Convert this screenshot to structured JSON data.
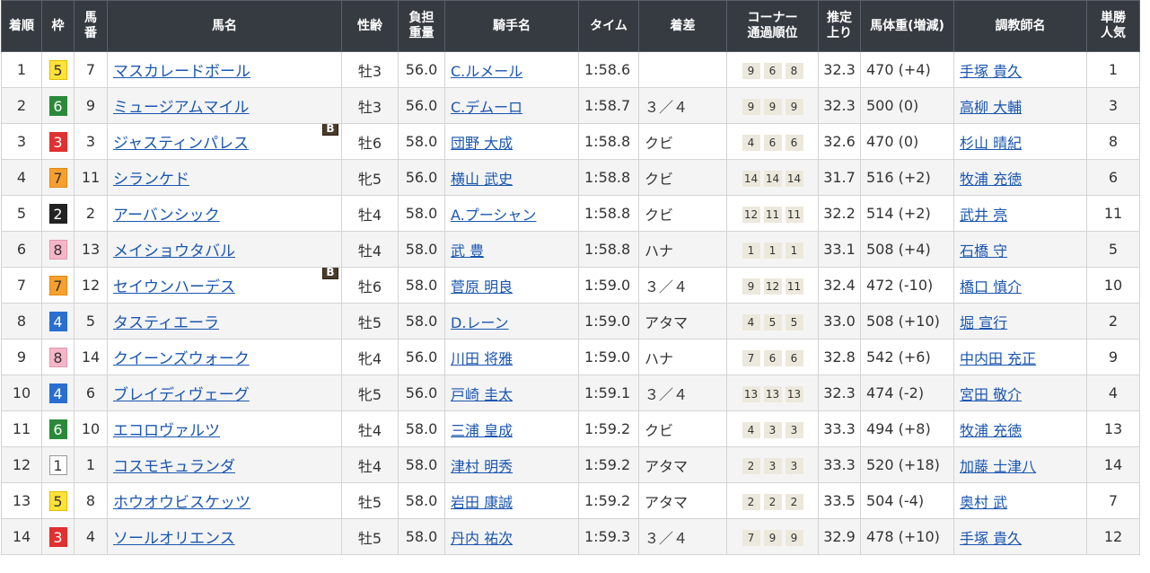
{
  "headers": {
    "rank": "着順",
    "waku": "枠",
    "num": "馬番",
    "horse": "馬名",
    "sexage": "性齢",
    "weight": "負担重量",
    "jockey": "騎手名",
    "time": "タイム",
    "margin": "着差",
    "corner": "コーナー通過順位",
    "last3f": "推定上り",
    "body": "馬体重(増減)",
    "trainer": "調教師名",
    "pop": "単勝人気"
  },
  "blinker_label": "B",
  "waku_colors": {
    "1": {
      "bg": "#ffffff",
      "fg": "#333333",
      "border": "#999999"
    },
    "2": {
      "bg": "#222222",
      "fg": "#ffffff",
      "border": "#222222"
    },
    "3": {
      "bg": "#e03030",
      "fg": "#ffffff",
      "border": "#e03030"
    },
    "4": {
      "bg": "#2a6fd0",
      "fg": "#ffffff",
      "border": "#2a6fd0"
    },
    "5": {
      "bg": "#ffe23a",
      "fg": "#333333",
      "border": "#e0c000"
    },
    "6": {
      "bg": "#2a8a3a",
      "fg": "#ffffff",
      "border": "#2a8a3a"
    },
    "7": {
      "bg": "#f7a030",
      "fg": "#333333",
      "border": "#e08a10"
    },
    "8": {
      "bg": "#f7b6c8",
      "fg": "#333333",
      "border": "#e09ab0"
    }
  },
  "rows": [
    {
      "rank": "1",
      "waku": "5",
      "num": "7",
      "horse": "マスカレードボール",
      "blinker": false,
      "sexage": "牡3",
      "weight": "56.0",
      "jockey": "C.ルメール",
      "time": "1:58.6",
      "margin": "",
      "corner": [
        "9",
        "6",
        "8"
      ],
      "last3f": "32.3",
      "body": "470 (+4)",
      "trainer": "手塚 貴久",
      "pop": "1"
    },
    {
      "rank": "2",
      "waku": "6",
      "num": "9",
      "horse": "ミュージアムマイル",
      "blinker": false,
      "sexage": "牡3",
      "weight": "56.0",
      "jockey": "C.デムーロ",
      "time": "1:58.7",
      "margin": "３／４",
      "corner": [
        "9",
        "9",
        "9"
      ],
      "last3f": "32.3",
      "body": "500 (0)",
      "trainer": "高柳 大輔",
      "pop": "3"
    },
    {
      "rank": "3",
      "waku": "3",
      "num": "3",
      "horse": "ジャスティンパレス",
      "blinker": true,
      "sexage": "牡6",
      "weight": "58.0",
      "jockey": "団野 大成",
      "time": "1:58.8",
      "margin": "クビ",
      "corner": [
        "4",
        "6",
        "6"
      ],
      "last3f": "32.6",
      "body": "470 (0)",
      "trainer": "杉山 晴紀",
      "pop": "8"
    },
    {
      "rank": "4",
      "waku": "7",
      "num": "11",
      "horse": "シランケド",
      "blinker": false,
      "sexage": "牝5",
      "weight": "56.0",
      "jockey": "横山 武史",
      "time": "1:58.8",
      "margin": "クビ",
      "corner": [
        "14",
        "14",
        "14"
      ],
      "last3f": "31.7",
      "body": "516 (+2)",
      "trainer": "牧浦 充徳",
      "pop": "6"
    },
    {
      "rank": "5",
      "waku": "2",
      "num": "2",
      "horse": "アーバンシック",
      "blinker": false,
      "sexage": "牡4",
      "weight": "58.0",
      "jockey": "A.プーシャン",
      "time": "1:58.8",
      "margin": "クビ",
      "corner": [
        "12",
        "11",
        "11"
      ],
      "last3f": "32.2",
      "body": "514 (+2)",
      "trainer": "武井 亮",
      "pop": "11"
    },
    {
      "rank": "6",
      "waku": "8",
      "num": "13",
      "horse": "メイショウタバル",
      "blinker": false,
      "sexage": "牡4",
      "weight": "58.0",
      "jockey": "武 豊",
      "time": "1:58.8",
      "margin": "ハナ",
      "corner": [
        "1",
        "1",
        "1"
      ],
      "last3f": "33.1",
      "body": "508 (+4)",
      "trainer": "石橋 守",
      "pop": "5"
    },
    {
      "rank": "7",
      "waku": "7",
      "num": "12",
      "horse": "セイウンハーデス",
      "blinker": true,
      "sexage": "牡6",
      "weight": "58.0",
      "jockey": "菅原 明良",
      "time": "1:59.0",
      "margin": "３／４",
      "corner": [
        "9",
        "12",
        "11"
      ],
      "last3f": "32.4",
      "body": "472 (-10)",
      "trainer": "橋口 慎介",
      "pop": "10"
    },
    {
      "rank": "8",
      "waku": "4",
      "num": "5",
      "horse": "タスティエーラ",
      "blinker": false,
      "sexage": "牡5",
      "weight": "58.0",
      "jockey": "D.レーン",
      "time": "1:59.0",
      "margin": "アタマ",
      "corner": [
        "4",
        "5",
        "5"
      ],
      "last3f": "33.0",
      "body": "508 (+10)",
      "trainer": "堀 宣行",
      "pop": "2"
    },
    {
      "rank": "9",
      "waku": "8",
      "num": "14",
      "horse": "クイーンズウォーク",
      "blinker": false,
      "sexage": "牝4",
      "weight": "56.0",
      "jockey": "川田 将雅",
      "time": "1:59.0",
      "margin": "ハナ",
      "corner": [
        "7",
        "6",
        "6"
      ],
      "last3f": "32.8",
      "body": "542 (+6)",
      "trainer": "中内田 充正",
      "pop": "9"
    },
    {
      "rank": "10",
      "waku": "4",
      "num": "6",
      "horse": "ブレイディヴェーグ",
      "blinker": false,
      "sexage": "牝5",
      "weight": "56.0",
      "jockey": "戸崎 圭太",
      "time": "1:59.1",
      "margin": "３／４",
      "corner": [
        "13",
        "13",
        "13"
      ],
      "last3f": "32.3",
      "body": "474 (-2)",
      "trainer": "宮田 敬介",
      "pop": "4"
    },
    {
      "rank": "11",
      "waku": "6",
      "num": "10",
      "horse": "エコロヴァルツ",
      "blinker": false,
      "sexage": "牡4",
      "weight": "58.0",
      "jockey": "三浦 皇成",
      "time": "1:59.2",
      "margin": "クビ",
      "corner": [
        "4",
        "3",
        "3"
      ],
      "last3f": "33.3",
      "body": "494 (+8)",
      "trainer": "牧浦 充徳",
      "pop": "13"
    },
    {
      "rank": "12",
      "waku": "1",
      "num": "1",
      "horse": "コスモキュランダ",
      "blinker": false,
      "sexage": "牡4",
      "weight": "58.0",
      "jockey": "津村 明秀",
      "time": "1:59.2",
      "margin": "アタマ",
      "corner": [
        "2",
        "3",
        "3"
      ],
      "last3f": "33.3",
      "body": "520 (+18)",
      "trainer": "加藤 士津八",
      "pop": "14"
    },
    {
      "rank": "13",
      "waku": "5",
      "num": "8",
      "horse": "ホウオウビスケッツ",
      "blinker": false,
      "sexage": "牡5",
      "weight": "58.0",
      "jockey": "岩田 康誠",
      "time": "1:59.2",
      "margin": "アタマ",
      "corner": [
        "2",
        "2",
        "2"
      ],
      "last3f": "33.5",
      "body": "504 (-4)",
      "trainer": "奥村 武",
      "pop": "7"
    },
    {
      "rank": "14",
      "waku": "3",
      "num": "4",
      "horse": "ソールオリエンス",
      "blinker": false,
      "sexage": "牡5",
      "weight": "58.0",
      "jockey": "丹内 祐次",
      "time": "1:59.3",
      "margin": "３／４",
      "corner": [
        "7",
        "9",
        "9"
      ],
      "last3f": "32.9",
      "body": "478 (+10)",
      "trainer": "手塚 貴久",
      "pop": "12"
    }
  ]
}
